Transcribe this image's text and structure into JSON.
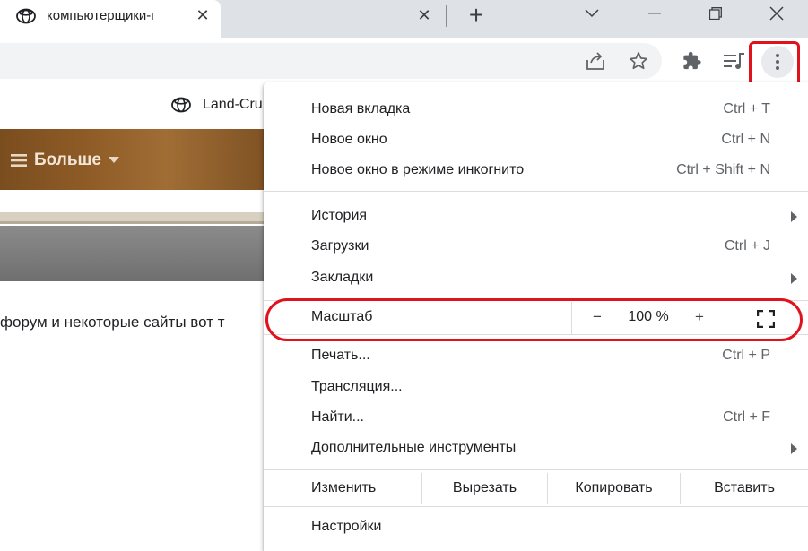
{
  "browser": {
    "tab_title": "компьютерщики-г",
    "tab_close": "✕",
    "tab2_close": "✕",
    "new_tab": "+"
  },
  "page": {
    "bookmark_label": "Land-Cru",
    "nav_more_label": "Больше",
    "body_text": "форум и некоторые сайты вот т"
  },
  "menu": {
    "group1": [
      {
        "label": "Новая вкладка",
        "shortcut": "Ctrl + T"
      },
      {
        "label": "Новое окно",
        "shortcut": "Ctrl + N"
      },
      {
        "label": "Новое окно в режиме инкогнито",
        "shortcut": "Ctrl + Shift + N"
      }
    ],
    "group2": [
      {
        "label": "История",
        "shortcut": ""
      },
      {
        "label": "Загрузки",
        "shortcut": "Ctrl + J"
      },
      {
        "label": "Закладки",
        "shortcut": ""
      }
    ],
    "zoom": {
      "label": "Масштаб",
      "minus": "−",
      "level": "100 %",
      "plus": "+"
    },
    "group3": [
      {
        "label": "Печать...",
        "shortcut": "Ctrl + P"
      },
      {
        "label": "Трансляция...",
        "shortcut": ""
      },
      {
        "label": "Найти...",
        "shortcut": "Ctrl + F"
      },
      {
        "label": "Дополнительные инструменты",
        "shortcut": ""
      }
    ],
    "edit": {
      "label": "Изменить",
      "cut": "Вырезать",
      "copy": "Копировать",
      "paste": "Вставить"
    },
    "settings": "Настройки"
  },
  "colors": {
    "highlight": "#e0121b",
    "tabstrip": "#dee1e6"
  }
}
